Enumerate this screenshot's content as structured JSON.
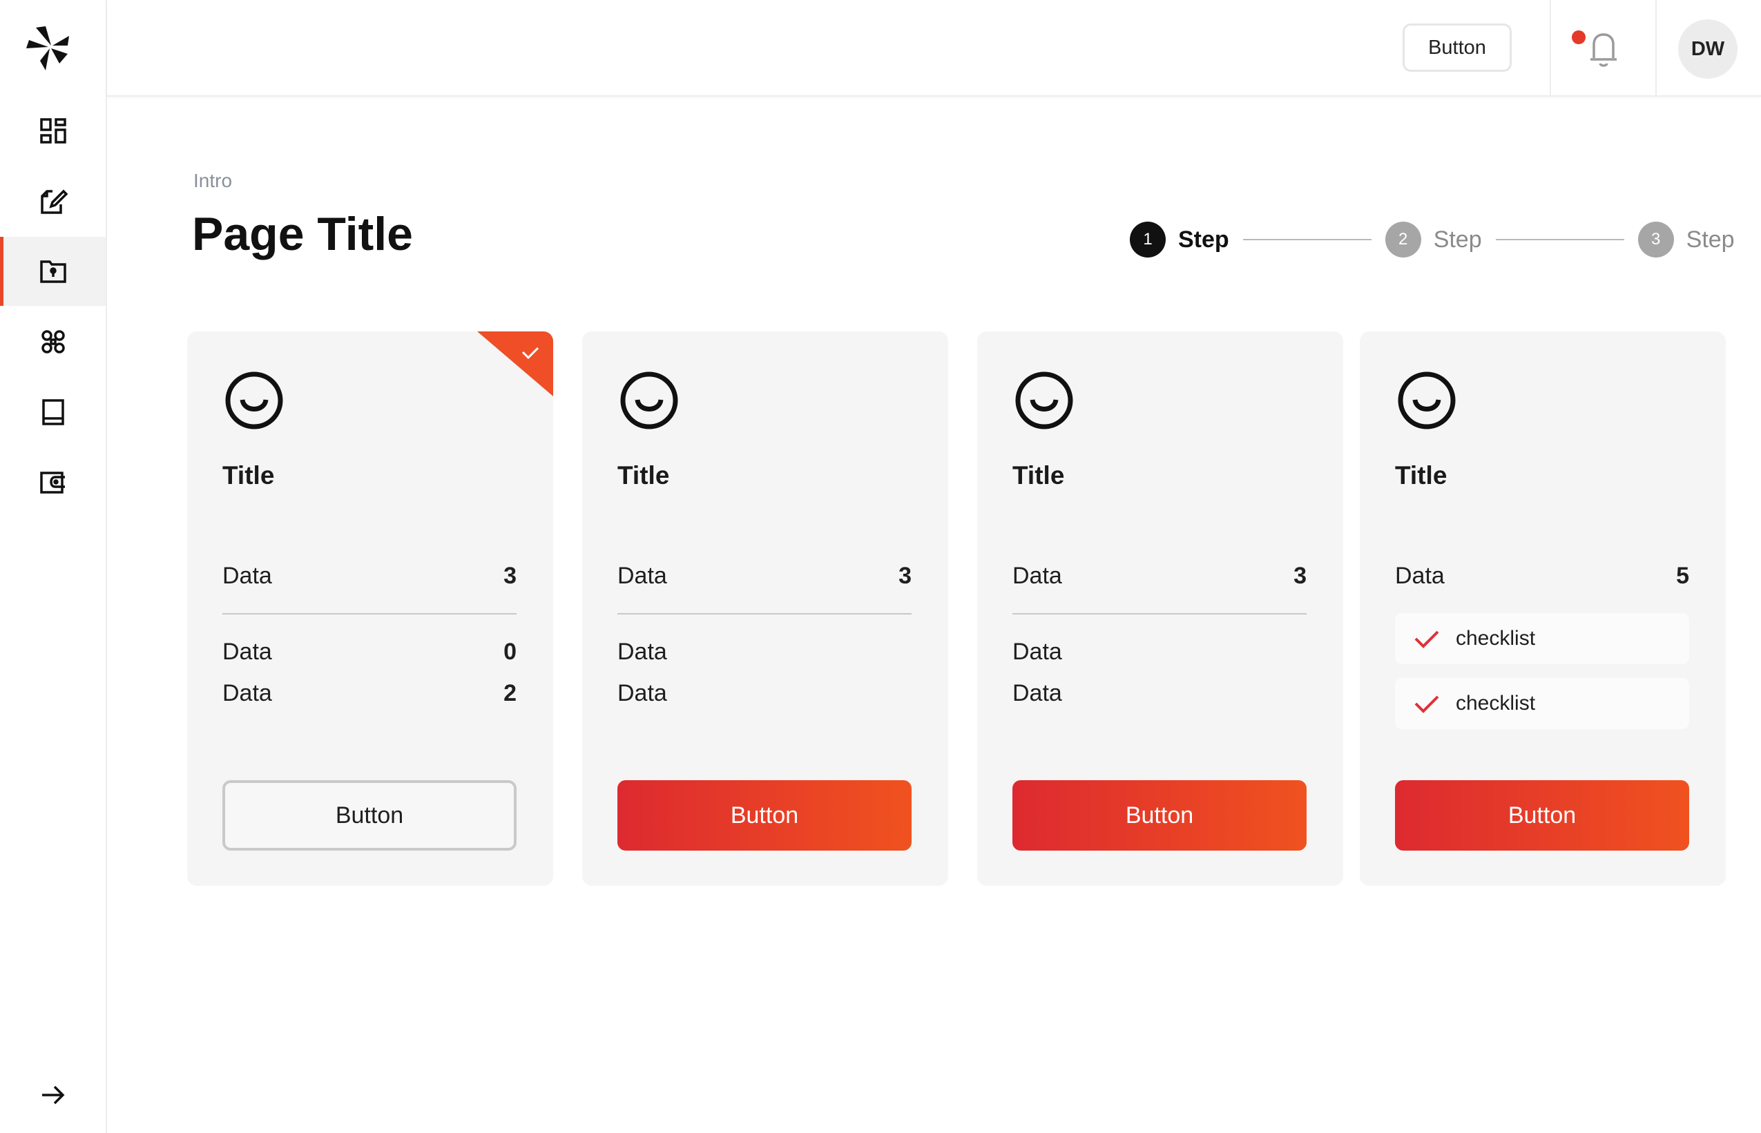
{
  "sidebar": {
    "items": [
      {
        "icon": "dashboard-icon"
      },
      {
        "icon": "edit-document-icon"
      },
      {
        "icon": "folder-lock-icon",
        "active": true
      },
      {
        "icon": "command-icon"
      },
      {
        "icon": "book-icon"
      },
      {
        "icon": "wallet-icon"
      }
    ],
    "collapse_icon": "arrow-right-icon"
  },
  "topbar": {
    "button_label": "Button",
    "notifications": {
      "icon": "bell-icon",
      "has_unread": true
    },
    "avatar_initials": "DW"
  },
  "header": {
    "eyebrow": "Intro",
    "title": "Page Title"
  },
  "stepper": {
    "steps": [
      {
        "number": "1",
        "label": "Step",
        "active": true
      },
      {
        "number": "2",
        "label": "Step",
        "active": false
      },
      {
        "number": "3",
        "label": "Step",
        "active": false
      }
    ]
  },
  "cards": [
    {
      "title": "Title",
      "selected": true,
      "rows": [
        {
          "label": "Data",
          "value": "3"
        },
        {
          "label": "Data",
          "value": "0"
        },
        {
          "label": "Data",
          "value": "2"
        }
      ],
      "button_label": "Button",
      "button_style": "outline"
    },
    {
      "title": "Title",
      "selected": false,
      "rows": [
        {
          "label": "Data",
          "value": "3"
        },
        {
          "label": "Data",
          "value": ""
        },
        {
          "label": "Data",
          "value": ""
        }
      ],
      "button_label": "Button",
      "button_style": "filled"
    },
    {
      "title": "Title",
      "selected": false,
      "rows": [
        {
          "label": "Data",
          "value": "3"
        },
        {
          "label": "Data",
          "value": ""
        },
        {
          "label": "Data",
          "value": ""
        }
      ],
      "button_label": "Button",
      "button_style": "filled"
    },
    {
      "title": "Title",
      "selected": false,
      "rows": [
        {
          "label": "Data",
          "value": "5"
        }
      ],
      "checklist": [
        "checklist",
        "checklist"
      ],
      "button_label": "Button",
      "button_style": "filled"
    }
  ],
  "colors": {
    "accent": "#e9472a",
    "gradient_start": "#dd2a30",
    "gradient_end": "#f0521f",
    "notification_dot": "#e43a2a",
    "check": "#e0303a"
  }
}
